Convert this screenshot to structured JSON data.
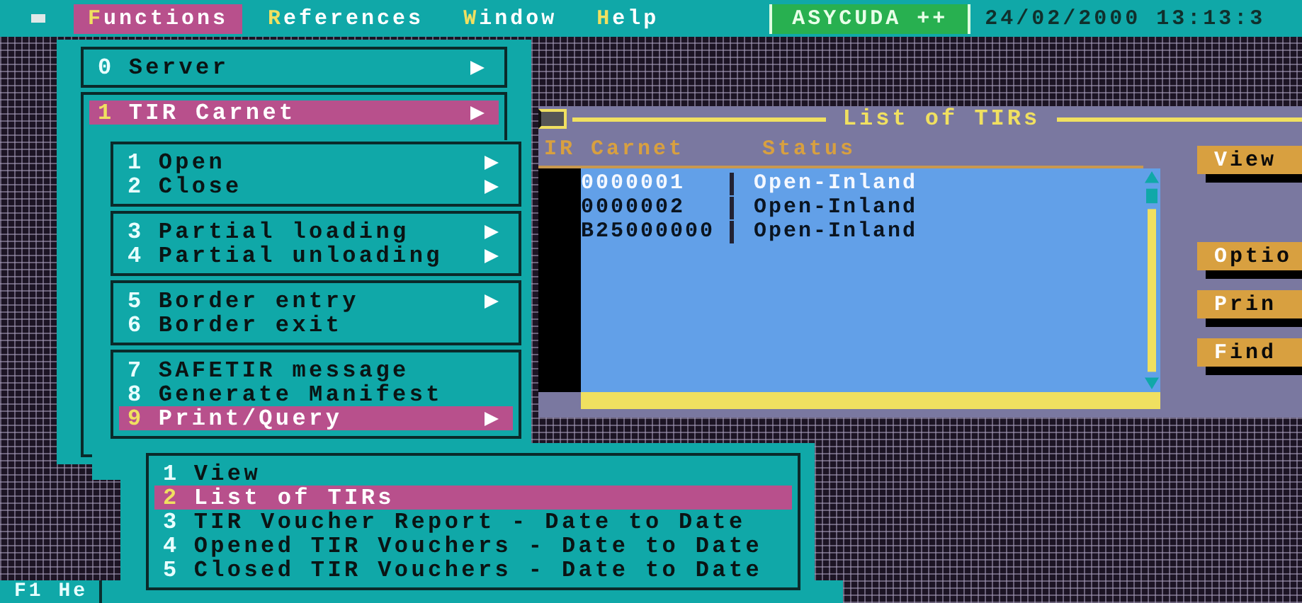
{
  "menu_bar": {
    "items": [
      {
        "label": "Functions",
        "selected": true
      },
      {
        "label": "References",
        "selected": false
      },
      {
        "label": "Window",
        "selected": false
      },
      {
        "label": "Help",
        "selected": false
      }
    ],
    "app_name": "ASYCUDA ++",
    "datetime": "24/02/2000 13:13:3"
  },
  "menus": [
    {
      "groups": [
        [
          {
            "key": "0",
            "label": "Server",
            "submenu": true,
            "selected": false
          }
        ],
        [
          {
            "key": "1",
            "label": "TIR Carnet",
            "submenu": true,
            "selected": true
          }
        ]
      ]
    },
    {
      "groups": [
        [
          {
            "key": "1",
            "label": "Open",
            "submenu": true,
            "selected": false
          },
          {
            "key": "2",
            "label": "Close",
            "submenu": true,
            "selected": false
          }
        ],
        [
          {
            "key": "3",
            "label": "Partial loading",
            "submenu": true,
            "selected": false
          },
          {
            "key": "4",
            "label": "Partial unloading",
            "submenu": true,
            "selected": false
          }
        ],
        [
          {
            "key": "5",
            "label": "Border entry",
            "submenu": true,
            "selected": false
          },
          {
            "key": "6",
            "label": "Border exit",
            "submenu": false,
            "selected": false
          }
        ],
        [
          {
            "key": "7",
            "label": "SAFETIR message",
            "submenu": false,
            "selected": false
          },
          {
            "key": "8",
            "label": "Generate Manifest",
            "submenu": false,
            "selected": false
          },
          {
            "key": "9",
            "label": "Print/Query",
            "submenu": true,
            "selected": true
          }
        ]
      ]
    },
    {
      "groups": [
        [
          {
            "key": "1",
            "label": "View",
            "submenu": false,
            "selected": false
          },
          {
            "key": "2",
            "label": "List of TIRs",
            "submenu": false,
            "selected": true
          },
          {
            "key": "3",
            "label": "TIR Voucher Report - Date to Date",
            "submenu": false,
            "selected": false
          },
          {
            "key": "4",
            "label": "Opened TIR Vouchers - Date to Date",
            "submenu": false,
            "selected": false
          },
          {
            "key": "5",
            "label": "Closed TIR Vouchers - Date to Date",
            "submenu": false,
            "selected": false
          }
        ]
      ]
    }
  ],
  "window": {
    "title": "List of TIRs",
    "columns": [
      "IR Carnet",
      "Status"
    ],
    "rows": [
      {
        "cells": [
          "0000001",
          "Open-Inland"
        ],
        "selected": true
      },
      {
        "cells": [
          "0000002",
          "Open-Inland"
        ],
        "selected": false
      },
      {
        "cells": [
          "B25000000",
          "Open-Inland"
        ],
        "selected": false
      }
    ],
    "buttons": [
      "View",
      "Optio",
      "Prin",
      "Find"
    ]
  },
  "status_bar": {
    "text": "F1 He"
  }
}
